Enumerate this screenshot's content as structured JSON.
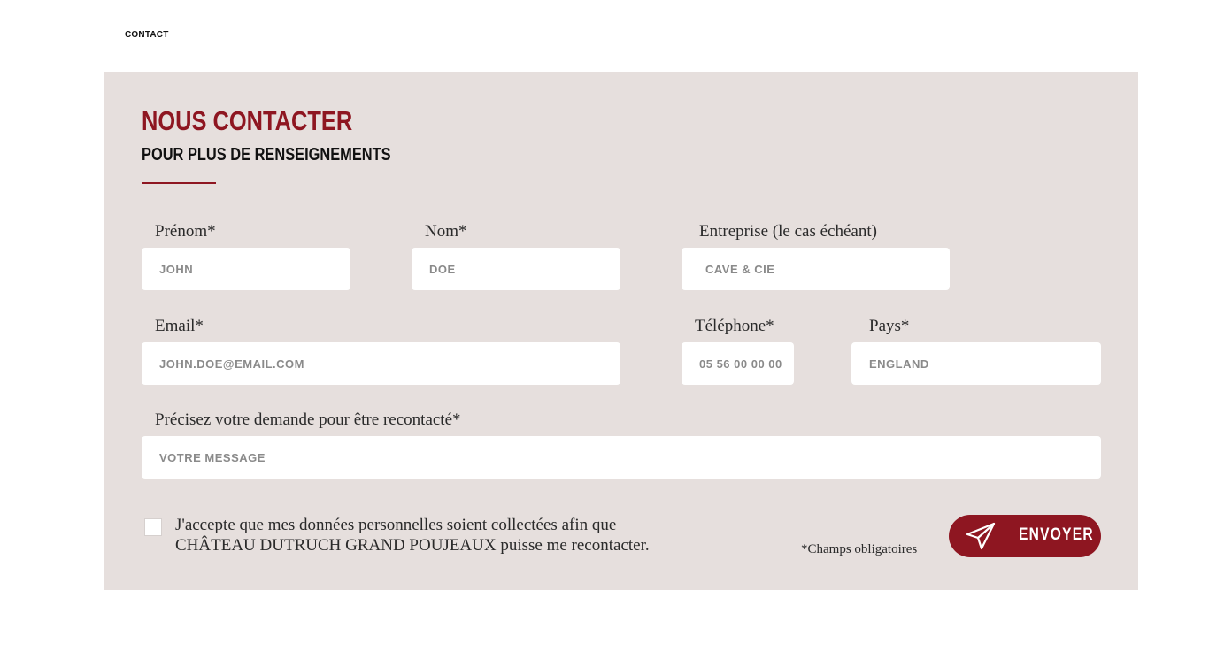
{
  "breadcrumb": "CONTACT",
  "header": {
    "title": "NOUS CONTACTER",
    "subtitle": "POUR PLUS DE RENSEIGNEMENTS"
  },
  "form": {
    "firstname": {
      "label": "Prénom*",
      "placeholder": "JOHN"
    },
    "lastname": {
      "label": "Nom*",
      "placeholder": "DOE"
    },
    "company": {
      "label": "Entreprise (le cas échéant)",
      "placeholder": "CAVE & CIE"
    },
    "email": {
      "label": "Email*",
      "placeholder": "JOHN.DOE@EMAIL.COM"
    },
    "phone": {
      "label": "Téléphone*",
      "placeholder": "05 56 00 00 00"
    },
    "country": {
      "label": "Pays*",
      "placeholder": "ENGLAND"
    },
    "message": {
      "label": "Précisez votre demande pour être recontacté*",
      "placeholder": "VOTRE MESSAGE"
    },
    "consent_line1": "J'accepte que mes données personnelles soient collectées afin que",
    "consent_line2": "CHÂTEAU DUTRUCH GRAND POUJEAUX puisse me recontacter.",
    "required_note": "*Champs obligatoires",
    "submit_label": "ENVOYER",
    "submit_icon": "paper-plane-icon"
  },
  "colors": {
    "accent": "#8e1621",
    "panel_bg": "#e6dfdd"
  }
}
